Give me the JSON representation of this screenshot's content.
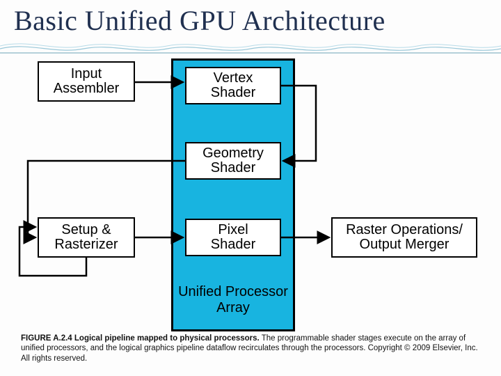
{
  "title": "Basic Unified GPU Architecture",
  "boxes": {
    "input_assembler": "Input\nAssembler",
    "setup_rasterizer": "Setup &\nRasterizer",
    "vertex_shader": "Vertex\nShader",
    "geometry_shader": "Geometry\nShader",
    "pixel_shader": "Pixel\nShader",
    "raster_ops": "Raster Operations/\nOutput Merger",
    "unified_processor_array": "Unified Processor\nArray"
  },
  "caption": {
    "bold": "FIGURE A.2.4 Logical pipeline mapped to physical processors.",
    "rest": " The programmable shader stages execute on the array of unified processors, and the logical graphics pipeline dataflow recirculates through the processors. Copyright © 2009 Elsevier, Inc. All rights reserved."
  }
}
